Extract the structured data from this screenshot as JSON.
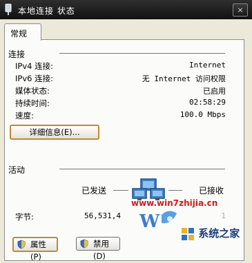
{
  "window": {
    "title": "本地连接 状态",
    "close_glyph": "×"
  },
  "tabs": [
    {
      "label": "常规"
    }
  ],
  "connection": {
    "section_title": "连接",
    "rows": [
      {
        "label": "IPv4 连接:",
        "value": "Internet"
      },
      {
        "label": "IPv6 连接:",
        "value": "无 Internet 访问权限"
      },
      {
        "label": "媒体状态:",
        "value": "已启用"
      },
      {
        "label": "持续时间:",
        "value": "02:58:29"
      },
      {
        "label": "速度:",
        "value": "100.0 Mbps"
      }
    ],
    "details_button": "详细信息(E)..."
  },
  "activity": {
    "section_title": "活动",
    "sent_label": "已发送",
    "received_label": "已接收",
    "bytes_label": "字节:",
    "bytes_sent": "56,531,4",
    "bytes_received": "1"
  },
  "buttons": {
    "properties": "属性(P)",
    "disable": "禁用(D)"
  },
  "watermark": {
    "url": "www.win7zhijia.cn",
    "site_name": "系统之家"
  },
  "icons": {
    "app": "network-connection-icon",
    "network": "computers-network-icon",
    "shield": "uac-shield-icon"
  }
}
